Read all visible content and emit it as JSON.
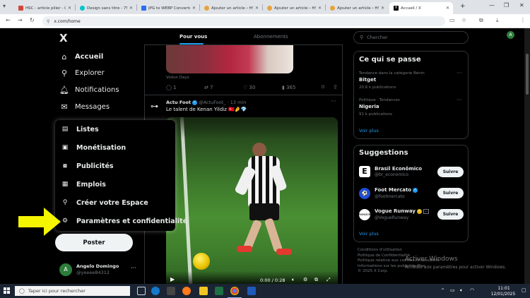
{
  "browser": {
    "tabs": [
      {
        "title": "HSC - article pilier - Co",
        "color": "#d44638"
      },
      {
        "title": "Design sans titre - 750",
        "color": "#00c4cc"
      },
      {
        "title": "JPG to WEBP Converte",
        "color": "#2a6df4"
      },
      {
        "title": "Ajouter un article ‹ HS",
        "color": "#e8a33a"
      },
      {
        "title": "Ajouter un article ‹ HS",
        "color": "#e8a33a"
      },
      {
        "title": "Ajouter un article ‹ HS",
        "color": "#e8a33a"
      },
      {
        "title": "Accueil / X",
        "color": "#000000"
      }
    ],
    "new_tab": "+",
    "url": "x.com/home",
    "profile_initial": "A"
  },
  "sidebar": {
    "logo": "X",
    "items": [
      {
        "label": "Accueil",
        "icon": "home-icon"
      },
      {
        "label": "Explorer",
        "icon": "search-icon"
      },
      {
        "label": "Notifications",
        "icon": "bell-icon"
      },
      {
        "label": "Messages",
        "icon": "mail-icon"
      }
    ],
    "more_menu": [
      {
        "label": "Listes",
        "icon": "list-icon"
      },
      {
        "label": "Monétisation",
        "icon": "money-icon"
      },
      {
        "label": "Publicités",
        "icon": "ads-icon"
      },
      {
        "label": "Emplois",
        "icon": "briefcase-icon"
      },
      {
        "label": "Créer votre Espace",
        "icon": "mic-icon"
      },
      {
        "label": "Paramètres et confidentialité",
        "icon": "gear-icon"
      }
    ],
    "post_button": "Poster",
    "account": {
      "name": "Angelo Domingo",
      "handle": "@yeeee84312",
      "initial": "A"
    }
  },
  "timeline": {
    "tabs": [
      "Pour vous",
      "Abonnements"
    ],
    "prev_post": {
      "source": "Vodun Days",
      "replies": "1",
      "reposts": "7",
      "likes": "30",
      "views": "365"
    },
    "post": {
      "author": "Actu Foot",
      "handle": "@ActuFoot_",
      "time": "13 min",
      "text": "Le talent de Kenan Yildiz 🇹🇷🤌💎",
      "video_time": "0:00 / 0:28"
    }
  },
  "right": {
    "search_placeholder": "Chercher",
    "trends_title": "Ce qui se passe",
    "trends": [
      {
        "context": "Tendance dans la catégorie Bénin",
        "name": "Bitget",
        "count": "20,6 k publications"
      },
      {
        "context": "Politique · Tendances",
        "name": "Nigeria",
        "count": "91 k publications"
      }
    ],
    "trends_more": "Voir plus",
    "suggest_title": "Suggestions",
    "suggestions": [
      {
        "name": "Brasil Econômico",
        "handle": "@br_economico",
        "verified": false
      },
      {
        "name": "Foot Mercato",
        "handle": "@footmercato",
        "verified": true
      },
      {
        "name": "Vogue Runway",
        "handle": "@VogueRunway",
        "verified": true
      }
    ],
    "follow_label": "Suivre",
    "suggest_more": "Voir plus",
    "footer": [
      "Conditions d'utilisation",
      "Politique de Confidentialité",
      "Politique relative aux cookies   Accessibilité",
      "Informations sur les publicités   Plus ···",
      "© 2025 X Corp."
    ],
    "watermark_title": "Activer Windows",
    "watermark_sub": "Accédez aux paramètres pour activer Windows."
  },
  "taskbar": {
    "search_placeholder": "Taper ici pour rechercher",
    "time": "11:01",
    "date": "12/01/2025"
  },
  "colors": {
    "accent": "#1d9bf0",
    "arrow": "#f5f500"
  }
}
